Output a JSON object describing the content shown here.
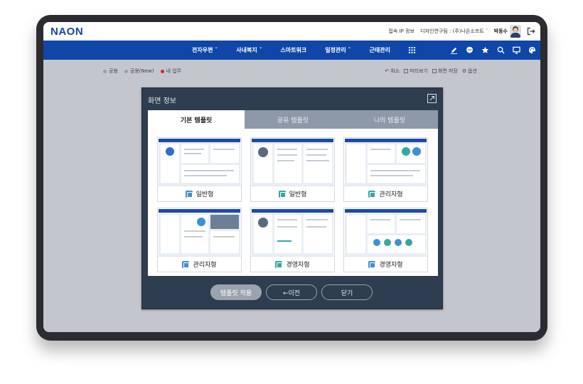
{
  "header": {
    "logo": "NAON",
    "ip_label": "접속 IP 정보",
    "dept": "디자인연구팀",
    "company": "(주)나온소프트",
    "user_name": "박동수"
  },
  "nav": {
    "items": [
      {
        "label": "전자우편 ˇ"
      },
      {
        "label": "사내복지 ˇ"
      },
      {
        "label": "스마트워크"
      },
      {
        "label": "일정관리 ˇ"
      },
      {
        "label": "근태관리"
      }
    ],
    "icons": [
      "pencil-icon",
      "chat-icon",
      "star-icon",
      "search-icon",
      "monitor-icon",
      "palette-icon"
    ]
  },
  "filters": {
    "items": [
      {
        "label": "공용",
        "color": "#9a9fa6"
      },
      {
        "label": "공용(New)",
        "color": "#9a9fa6"
      },
      {
        "label": "내 업무",
        "color": "#d9262c"
      }
    ]
  },
  "actions": {
    "cancel": "취소",
    "preview": "미리보기",
    "save": "화면 저장",
    "options": "옵션"
  },
  "modal": {
    "title": "화면 정보",
    "tabs": [
      {
        "label": "기본 템플릿",
        "active": true
      },
      {
        "label": "공유 템플릿",
        "active": false
      },
      {
        "label": "나의 템플릿",
        "active": false
      }
    ],
    "cards": [
      {
        "label": "일반형"
      },
      {
        "label": "일반형"
      },
      {
        "label": "관리자형"
      },
      {
        "label": "관리자형"
      },
      {
        "label": "경영자형"
      },
      {
        "label": "경영자형"
      }
    ],
    "buttons": {
      "apply": "템플릿 적용",
      "prev": "←이전",
      "close": "닫기"
    }
  },
  "colors": {
    "brand": "#0f46a8",
    "modal_bg": "#2e3d4f",
    "accent_red": "#d9262c"
  }
}
